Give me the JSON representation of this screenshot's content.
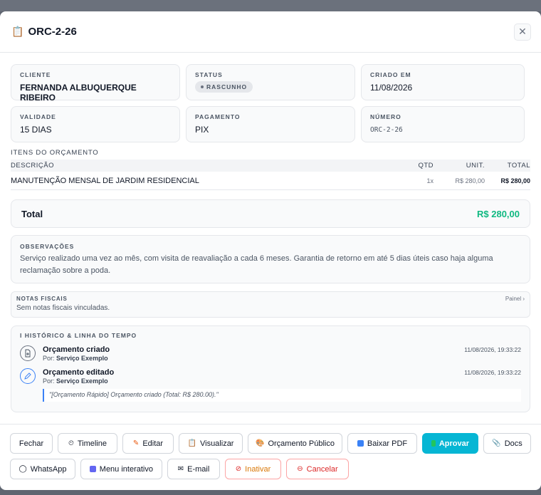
{
  "modal": {
    "title": "ORC-2-26",
    "close": "✕"
  },
  "fields": {
    "cliente_label": "CLIENTE",
    "cliente_value": "FERNANDA ALBUQUERQUE RIBEIRO",
    "status_label": "STATUS",
    "status_value": "RASCUNHO",
    "criado_label": "CRIADO EM",
    "criado_value": "11/08/2026",
    "validade_label": "VALIDADE",
    "validade_value": "15 DIAS",
    "pagamento_label": "PAGAMENTO",
    "pagamento_value": "PIX",
    "numero_label": "NÚMERO",
    "numero_value": "ORC-2-26"
  },
  "items": {
    "section_title": "ITENS DO ORÇAMENTO",
    "headers": {
      "desc": "DESCRIÇÃO",
      "qtd": "QTD",
      "unit": "UNIT.",
      "total": "TOTAL"
    },
    "rows": [
      {
        "desc": "MANUTENÇÃO MENSAL DE JARDIM RESIDENCIAL",
        "qtd": "1x",
        "unit": "R$ 280,00",
        "total": "R$ 280,00"
      }
    ]
  },
  "total": {
    "label": "Total",
    "value": "R$ 280,00"
  },
  "observacoes": {
    "label": "OBSERVAÇÕES",
    "text": "Serviço realizado uma vez ao mês, com visita de reavaliação a cada 6 meses. Garantia de retorno em até 5 dias úteis caso haja alguma reclamação sobre a poda."
  },
  "notas": {
    "label": "NOTAS FISCAIS",
    "link": "Painel ›",
    "text": "Sem notas fiscais vinculadas."
  },
  "historico": {
    "label": "I HISTÓRICO & LINHA DO TEMPO",
    "events": [
      {
        "title": "Orçamento criado",
        "by_label": "Por:",
        "by": "Serviço Exemplo",
        "date": "11/08/2026, 19:33:22"
      },
      {
        "title": "Orçamento editado",
        "by_label": "Por:",
        "by": "Serviço Exemplo",
        "date": "11/08/2026, 19:33:22",
        "note": "\"[Orçamento Rápido] Orçamento criado (Total: R$ 280.00).\""
      }
    ]
  },
  "buttons": {
    "fechar": "Fechar",
    "timeline": "Timeline",
    "editar": "Editar",
    "visualizar": "Visualizar",
    "publico": "Orçamento Público",
    "pdf": "Baixar PDF",
    "aprovar": "Aprovar",
    "docs": "Docs",
    "whatsapp": "WhatsApp",
    "menu": "Menu interativo",
    "email": "E-mail",
    "inativar": "Inativar",
    "cancelar": "Cancelar"
  },
  "colors": {
    "accent": "#06b6d4",
    "total_green": "#10b981",
    "danger": "#dc2626",
    "warning": "#d97706"
  }
}
